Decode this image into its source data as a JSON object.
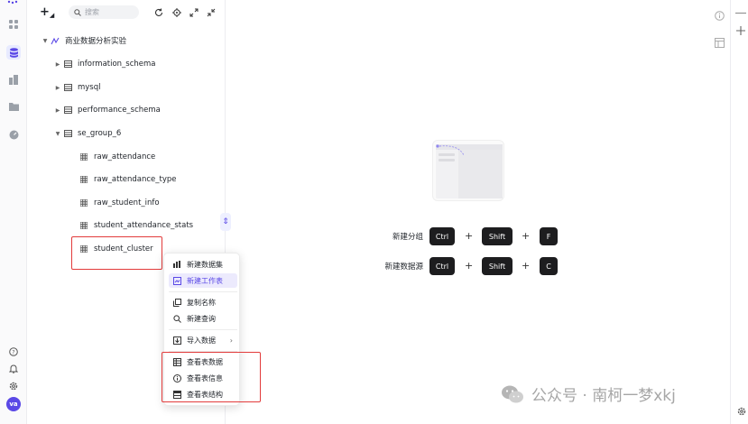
{
  "toolbar": {
    "search_placeholder": "搜索"
  },
  "tree": {
    "root": "商业数据分析实验",
    "schemas": [
      "information_schema",
      "mysql",
      "performance_schema",
      "se_group_6"
    ],
    "tables": [
      "raw_attendance",
      "raw_attendance_type",
      "raw_student_info",
      "student_attendance_stats",
      "student_cluster"
    ]
  },
  "menu": {
    "items": [
      "新建数据集",
      "新建工作表",
      "复制名称",
      "新建查询",
      "导入数据",
      "查看表数据",
      "查看表信息",
      "查看表结构"
    ],
    "highlighted_index": 1
  },
  "shortcuts": [
    {
      "label": "新建分组",
      "keys": [
        "Ctrl",
        "Shift",
        "F"
      ]
    },
    {
      "label": "新建数据源",
      "keys": [
        "Ctrl",
        "Shift",
        "C"
      ]
    }
  ],
  "shortcut_plus": "+",
  "avatar_initials": "va",
  "watermark": "公众号 · 南柯一梦xkj",
  "colors": {
    "accent": "#5a48e6",
    "highlight_box": "#e23b3b",
    "key_bg": "#1d1d1f"
  }
}
